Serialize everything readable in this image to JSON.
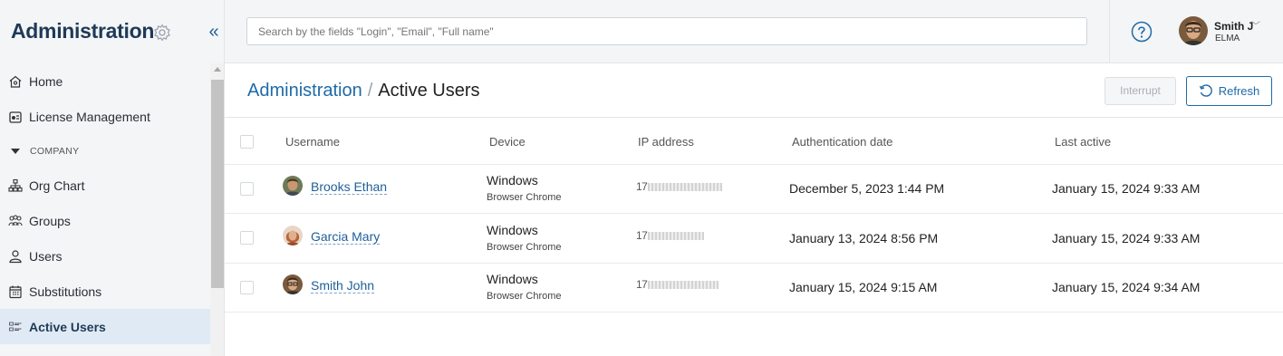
{
  "sidebar": {
    "title": "Administration",
    "items": [
      {
        "label": "Home",
        "icon": "home-icon"
      },
      {
        "label": "License Management",
        "icon": "license-icon"
      },
      {
        "label": "COMPANY",
        "icon": "caret-down-icon",
        "section": true
      },
      {
        "label": "Org Chart",
        "icon": "org-chart-icon"
      },
      {
        "label": "Groups",
        "icon": "groups-icon"
      },
      {
        "label": "Users",
        "icon": "user-icon"
      },
      {
        "label": "Substitutions",
        "icon": "calendar-icon"
      },
      {
        "label": "Active Users",
        "icon": "active-users-icon",
        "active": true
      }
    ]
  },
  "topbar": {
    "search_placeholder": "Search by the fields \"Login\", \"Email\", \"Full name\"",
    "user": {
      "name": "Smith J",
      "org": "ELMA"
    }
  },
  "page": {
    "breadcrumb_root": "Administration",
    "breadcrumb_sep": "/",
    "breadcrumb_current": "Active Users",
    "interrupt_label": "Interrupt",
    "refresh_label": "Refresh"
  },
  "table": {
    "columns": [
      "Username",
      "Device",
      "IP address",
      "Authentication date",
      "Last active"
    ],
    "rows": [
      {
        "username": "Brooks Ethan",
        "device": "Windows",
        "browser": "Browser Chrome",
        "ip": "17",
        "auth_date": "December 5, 2023 1:44 PM",
        "last_active": "January 15, 2024 9:33 AM"
      },
      {
        "username": "Garcia Mary",
        "device": "Windows",
        "browser": "Browser Chrome",
        "ip": "17",
        "auth_date": "January 13, 2024 8:56 PM",
        "last_active": "January 15, 2024 9:33 AM"
      },
      {
        "username": "Smith John",
        "device": "Windows",
        "browser": "Browser Chrome",
        "ip": "17",
        "auth_date": "January 15, 2024 9:15 AM",
        "last_active": "January 15, 2024 9:34 AM"
      }
    ]
  },
  "colors": {
    "accent": "#1e6aa8",
    "sidebar_bg": "#f3f5f7",
    "active_bg": "#dfeaf5"
  }
}
